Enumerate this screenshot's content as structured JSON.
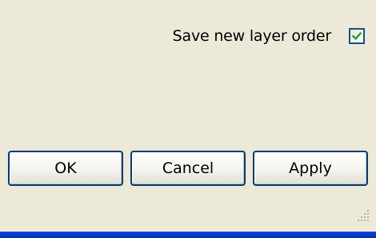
{
  "options": {
    "save_new_layer_order_label": "Save new layer order",
    "save_new_layer_order_checked": true
  },
  "buttons": {
    "ok_label": "OK",
    "cancel_label": "Cancel",
    "apply_label": "Apply"
  },
  "icons": {
    "checkmark": "checkmark-icon",
    "resize_grip": "resize-grip-icon"
  },
  "colors": {
    "dialog_background": "#ece9d8",
    "button_border": "#003c74",
    "checkmark": "#21a121",
    "taskbar": "#0a3ed8"
  }
}
